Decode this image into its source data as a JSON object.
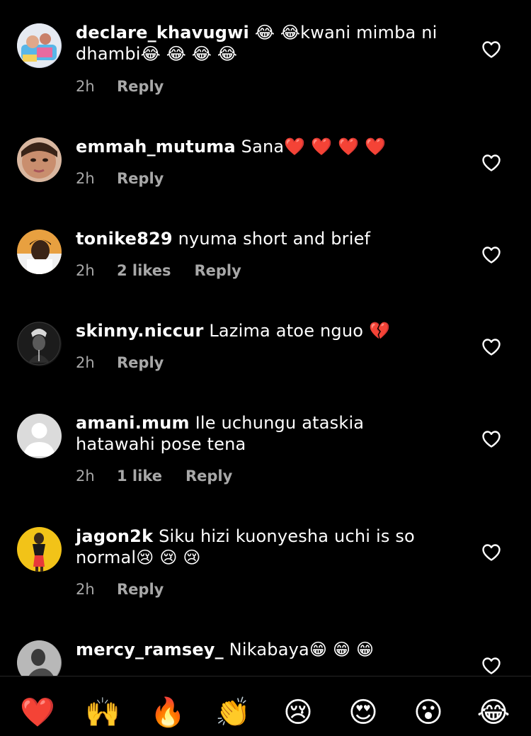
{
  "comments": [
    {
      "username": "declare_khavugwi",
      "text": " 😂 😂kwani mimba ni dhambi😂 😂 😂 😂",
      "time": "2h",
      "likes": "",
      "reply": "Reply",
      "avatar": "avatar-declare-khavugwi"
    },
    {
      "username": "emmah_mutuma",
      "text": " Sana❤️ ❤️ ❤️ ❤️",
      "time": "2h",
      "likes": "",
      "reply": "Reply",
      "avatar": "avatar-emmah-mutuma"
    },
    {
      "username": "tonike829",
      "text": " nyuma short and brief",
      "time": "2h",
      "likes": "2 likes",
      "reply": "Reply",
      "avatar": "avatar-tonike829"
    },
    {
      "username": "skinny.niccur",
      "text": " Lazima atoe nguo 💔",
      "time": "2h",
      "likes": "",
      "reply": "Reply",
      "avatar": "avatar-skinny-niccur"
    },
    {
      "username": "amani.mum",
      "text": " Ile uchungu ataskia hatawahi pose tena",
      "time": "2h",
      "likes": "1 like",
      "reply": "Reply",
      "avatar": "avatar-default-user"
    },
    {
      "username": "jagon2k",
      "text": " Siku hizi kuonyesha uchi is so normal😢 😢 😢",
      "time": "2h",
      "likes": "",
      "reply": "Reply",
      "avatar": "avatar-jagon2k"
    },
    {
      "username": "mercy_ramsey_",
      "text": " Nikabaya😁 😁 😁",
      "time": "",
      "likes": "",
      "reply": "",
      "avatar": "avatar-mercy-ramsey"
    }
  ],
  "icons": {
    "like": "heart-outline-icon"
  },
  "reactions": [
    "❤️",
    "🙌",
    "🔥",
    "👏",
    "😢",
    "😍",
    "😮",
    "😂"
  ],
  "colors": {
    "background": "#000000",
    "text": "#ffffff",
    "secondary_text": "#a8a8a8",
    "divider": "#262626"
  }
}
